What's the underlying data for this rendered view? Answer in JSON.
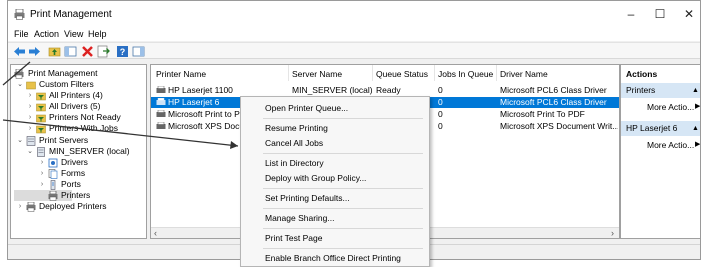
{
  "window": {
    "title": "Print Management",
    "controls": {
      "minimize": "–",
      "maximize": "☐",
      "close": "✕"
    }
  },
  "menu": [
    "File",
    "Action",
    "View",
    "Help"
  ],
  "tree": {
    "root": "Print Management",
    "custom_filters": "Custom Filters",
    "all_printers": "All Printers (4)",
    "all_drivers": "All Drivers (5)",
    "printers_not_ready": "Printers Not Ready",
    "printers_with_jobs": "Printers With Jobs",
    "print_servers": "Print Servers",
    "server": "MIN_SERVER (local)",
    "drivers": "Drivers",
    "forms": "Forms",
    "ports": "Ports",
    "printers": "Printers",
    "deployed_printers": "Deployed Printers"
  },
  "list": {
    "columns": [
      "Printer Name",
      "Server Name",
      "Queue Status",
      "Jobs In Queue",
      "Driver Name"
    ],
    "rows": [
      {
        "printer": "HP Laserjet 1100",
        "server": "MIN_SERVER (local)",
        "status": "Ready",
        "jobs": "0",
        "driver": "Microsoft PCL6 Class Driver"
      },
      {
        "printer": "HP Laserjet 6",
        "server": "",
        "status": "",
        "jobs": "0",
        "driver": "Microsoft PCL6 Class Driver"
      },
      {
        "printer": "Microsoft Print to PDF",
        "server": "",
        "status": "",
        "jobs": "0",
        "driver": "Microsoft Print To PDF"
      },
      {
        "printer": "Microsoft XPS Document Writer",
        "server": "",
        "status": "",
        "jobs": "0",
        "driver": "Microsoft XPS Document Writ..."
      }
    ]
  },
  "actions": {
    "title": "Actions",
    "section1": "Printers",
    "more1": "More Actio...",
    "section2": "HP Laserjet 6",
    "more2": "More Actio..."
  },
  "context_menu": {
    "items": [
      "Open Printer Queue...",
      "Resume Printing",
      "Cancel All Jobs",
      "List in Directory",
      "Deploy with Group Policy...",
      "Set Printing Defaults...",
      "Manage Sharing...",
      "Print Test Page",
      "Enable Branch Office Direct Printing"
    ]
  },
  "colors": {
    "selection": "#0078d7",
    "action_section": "#d6e6f5",
    "window_bg": "#f0f0f0"
  }
}
